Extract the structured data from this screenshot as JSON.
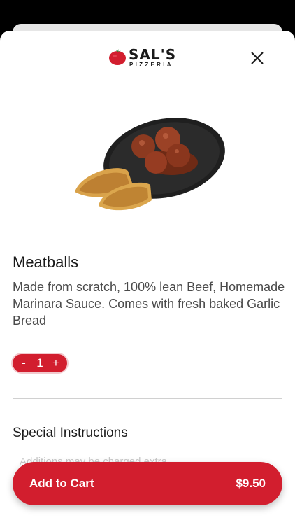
{
  "header": {
    "brand_name": "SAL'S",
    "brand_sub": "PIZZERIA",
    "logo_icon": "tomato-icon",
    "close_icon": "close-icon"
  },
  "item": {
    "image": "meatballs-food-photo",
    "name": "Meatballs",
    "description": "Made from scratch, 100% lean Beef, Homemade Marinara Sauce. Comes with fresh baked Garlic Bread"
  },
  "quantity": {
    "minus_label": "-",
    "value": "1",
    "plus_label": "+"
  },
  "special_instructions": {
    "title": "Special Instructions",
    "placeholder": "Additions may be charged extra"
  },
  "cart": {
    "label": "Add to Cart",
    "price": "$9.50"
  },
  "colors": {
    "accent": "#d21e2e",
    "text": "#1a1a1a",
    "muted_text": "#4a4a4a",
    "background": "#ffffff"
  }
}
